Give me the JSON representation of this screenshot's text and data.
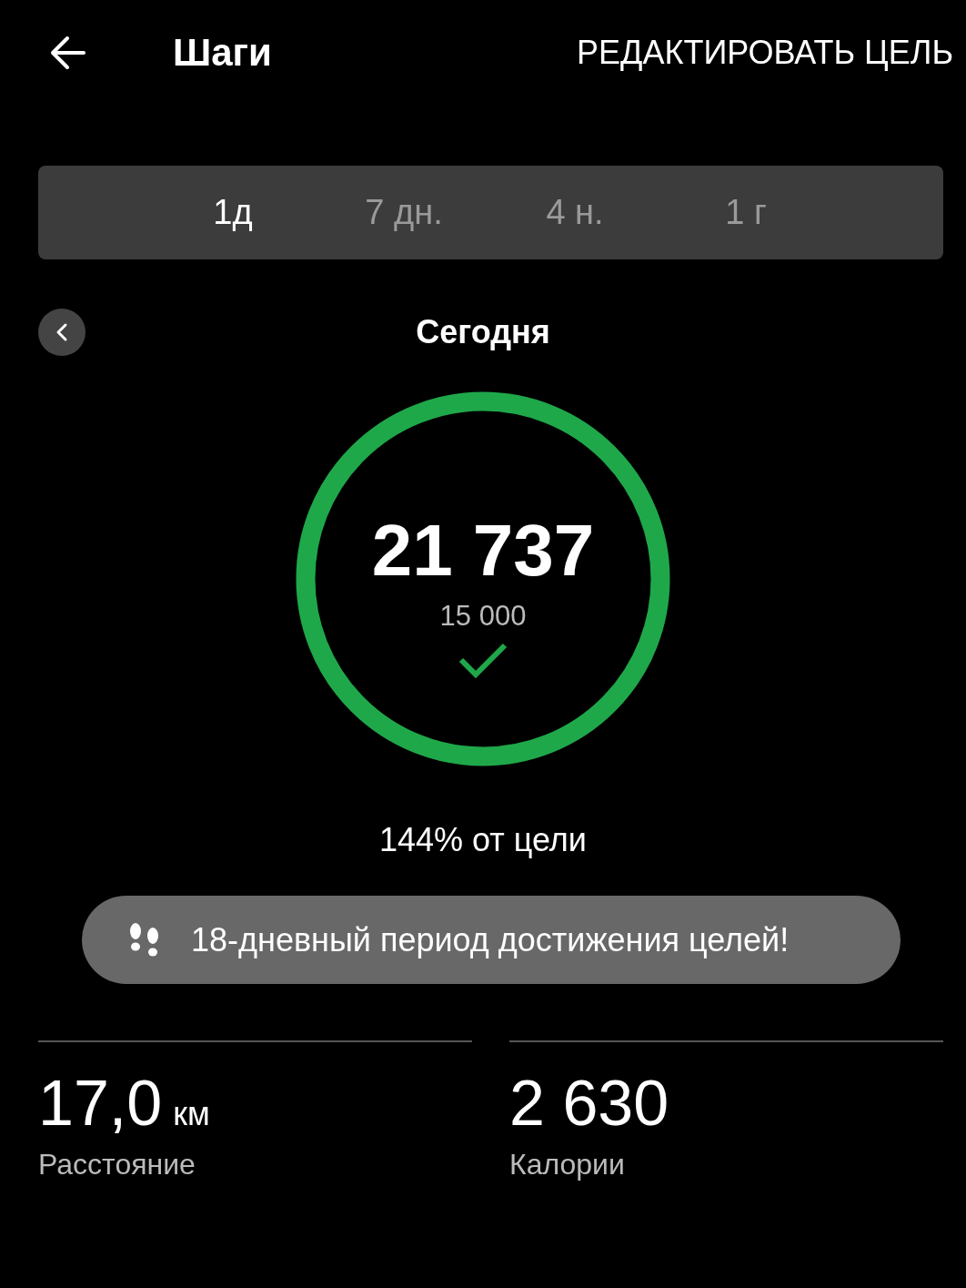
{
  "header": {
    "title": "Шаги",
    "action": "РЕДАКТИРОВАТЬ ЦЕЛЬ"
  },
  "tabs": [
    {
      "label": "1д",
      "selected": true
    },
    {
      "label": "7 дн.",
      "selected": false
    },
    {
      "label": "4 н.",
      "selected": false
    },
    {
      "label": "1 г",
      "selected": false
    }
  ],
  "period": {
    "label": "Сегодня"
  },
  "ring": {
    "level": 1,
    "steps": "21 737",
    "goal": "15 000",
    "goal_met": true
  },
  "percent_text": "144% от цели",
  "streak_banner": {
    "text": "18-дневный период достижения целей!"
  },
  "stats": [
    {
      "value": "17,0",
      "unit": "км",
      "label": "Расстояние"
    },
    {
      "value": "2 630",
      "label": "Калории"
    }
  ]
}
